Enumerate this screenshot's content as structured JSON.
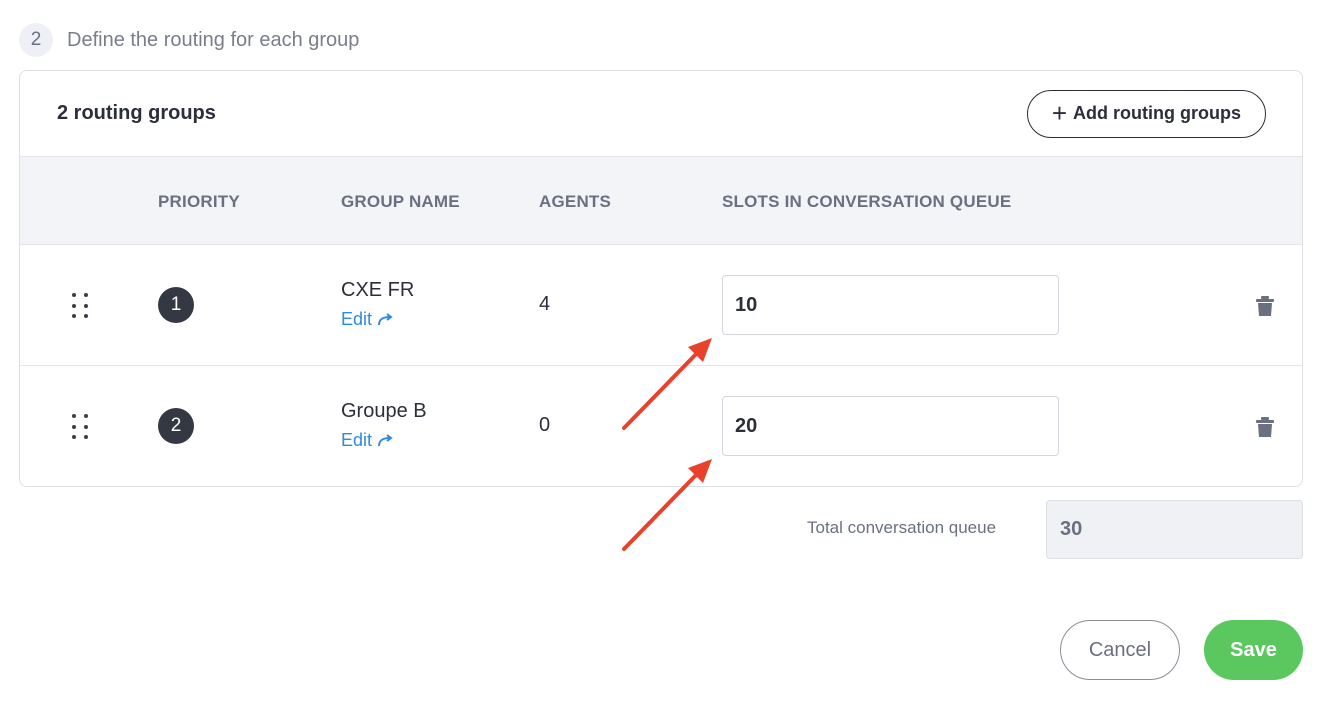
{
  "step": {
    "number": "2",
    "title": "Define the routing for each group"
  },
  "card": {
    "title": "2 routing groups",
    "add_button_label": "Add routing groups"
  },
  "table": {
    "headers": {
      "priority": "PRIORITY",
      "group_name": "GROUP NAME",
      "agents": "AGENTS",
      "slots": "SLOTS IN CONVERSATION QUEUE"
    },
    "rows": [
      {
        "priority": "1",
        "group_name": "CXE FR",
        "edit_label": "Edit",
        "agents": "4",
        "slots": "10"
      },
      {
        "priority": "2",
        "group_name": "Groupe B",
        "edit_label": "Edit",
        "agents": "0",
        "slots": "20"
      }
    ]
  },
  "total": {
    "label": "Total conversation queue",
    "value": "30"
  },
  "footer": {
    "cancel_label": "Cancel",
    "save_label": "Save"
  },
  "icons": {
    "add": "plus-icon",
    "drag": "drag-handle-icon",
    "edit": "redirect-arrow-icon",
    "delete": "trash-icon"
  },
  "colors": {
    "save_button": "#5ac85f",
    "link": "#2f8be0",
    "priority_badge": "#343843",
    "annotation_arrow": "#e8412c"
  }
}
